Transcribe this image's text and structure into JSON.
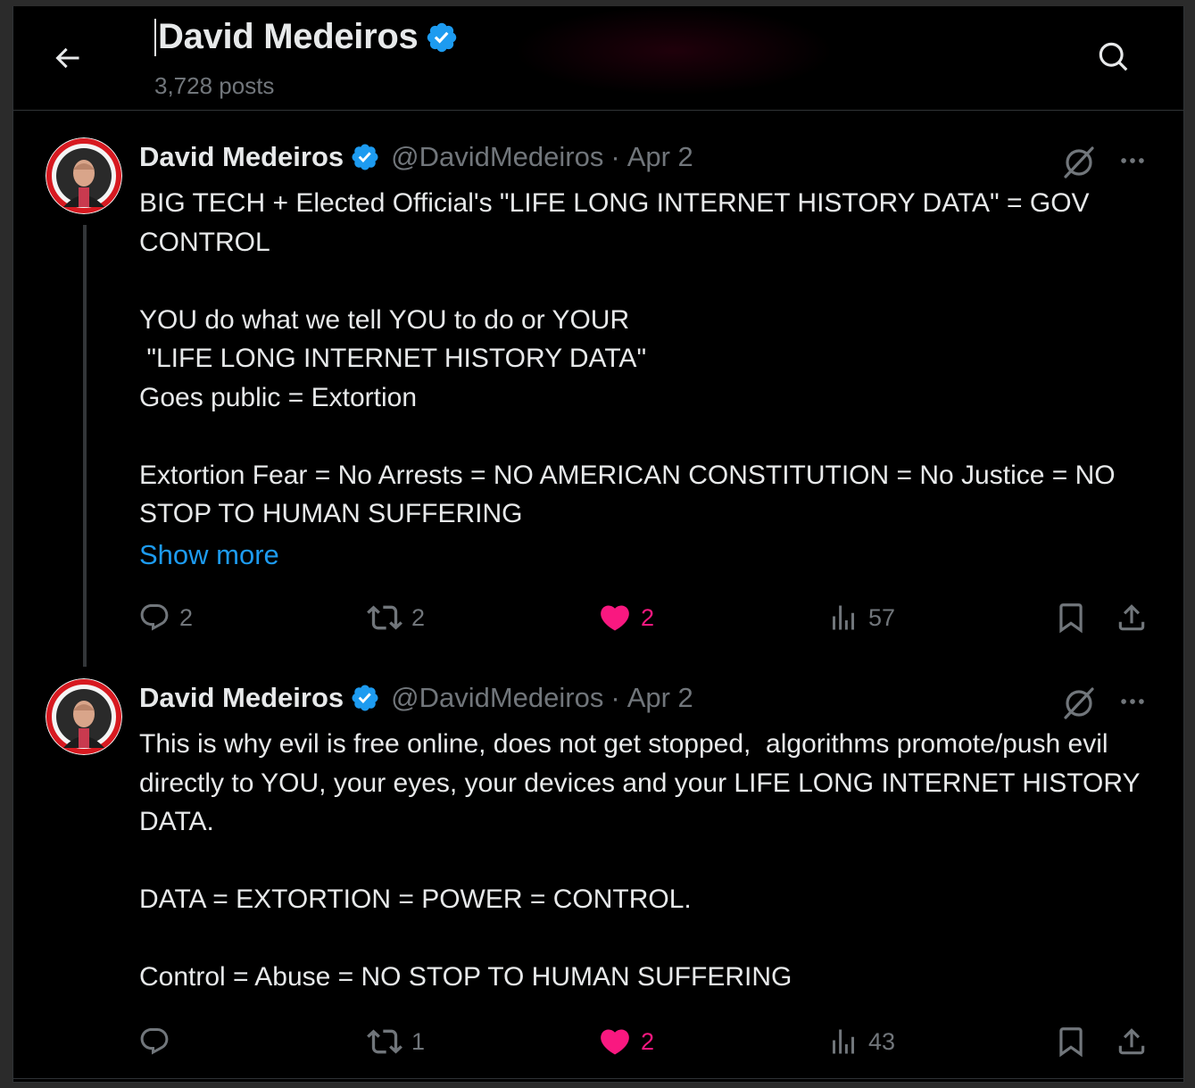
{
  "header": {
    "title": "David Medeiros",
    "subtitle": "3,728 posts"
  },
  "colors": {
    "background": "#000000",
    "text_primary": "#e7e9ea",
    "text_secondary": "#71767b",
    "accent_blue": "#1d9bf0",
    "like_pink": "#f91880"
  },
  "icons": {
    "back": "arrow-left-icon",
    "search": "search-icon",
    "verified": "verified-badge-icon",
    "grok": "grok-icon",
    "more": "more-dots-icon",
    "reply": "reply-icon",
    "repost": "repost-icon",
    "like": "heart-icon",
    "views": "views-chart-icon",
    "bookmark": "bookmark-icon",
    "share": "share-icon"
  },
  "posts": [
    {
      "author": "David Medeiros",
      "handle": "@DavidMedeiros",
      "separator": "·",
      "date": "Apr 2",
      "text": "BIG TECH + Elected Official's \"LIFE LONG INTERNET HISTORY DATA\" = GOV CONTROL\n\nYOU do what we tell YOU to do or YOUR\n \"LIFE LONG INTERNET HISTORY DATA\"\nGoes public = Extortion\n\nExtortion Fear = No Arrests = NO AMERICAN CONSTITUTION = No Justice = NO STOP TO HUMAN SUFFERING",
      "show_more": "Show more",
      "replies": "2",
      "reposts": "2",
      "likes": "2",
      "views": "57"
    },
    {
      "author": "David Medeiros",
      "handle": "@DavidMedeiros",
      "separator": "·",
      "date": "Apr 2",
      "text": "This is why evil is free online, does not get stopped,  algorithms promote/push evil directly to YOU, your eyes, your devices and your LIFE LONG INTERNET HISTORY DATA.\n\nDATA = EXTORTION = POWER = CONTROL.\n\nControl = Abuse = NO STOP TO HUMAN SUFFERING",
      "replies": "",
      "reposts": "1",
      "likes": "2",
      "views": "43"
    }
  ]
}
